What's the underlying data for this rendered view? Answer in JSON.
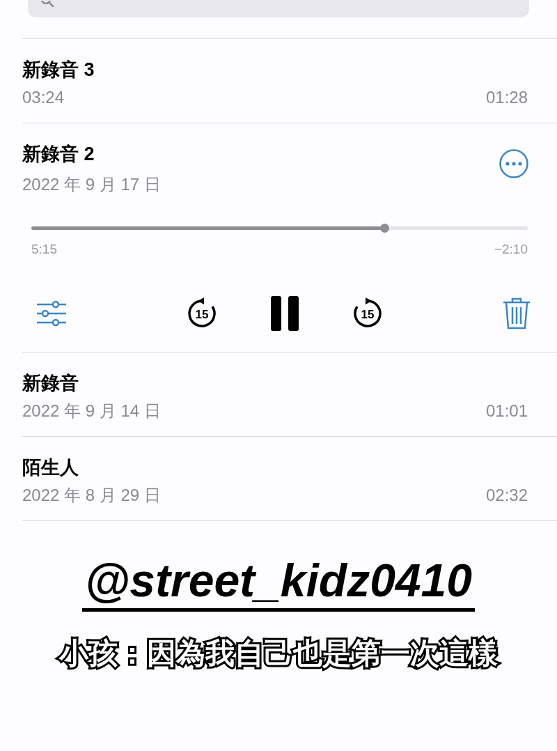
{
  "recordings": [
    {
      "title": "新錄音 3",
      "date": "03:24",
      "duration": "01:28",
      "expanded": false
    },
    {
      "title": "新錄音 2",
      "date": "2022 年 9 月 17 日",
      "expanded": true,
      "player": {
        "level": 0.711,
        "elapsed": "5:15",
        "remaining": "−2:10",
        "skip_back": "15",
        "skip_forward": "15",
        "playing": true
      }
    },
    {
      "title": "新錄音",
      "date": "2022 年 9 月 14 日",
      "duration": "01:01",
      "expanded": false
    },
    {
      "title": "陌生人",
      "date": "2022 年 8 月 29 日",
      "duration": "02:32",
      "expanded": false
    }
  ],
  "overlay": {
    "handle": "@street_kidz0410",
    "caption": "小孩：因為我自己也是第一次這樣"
  }
}
